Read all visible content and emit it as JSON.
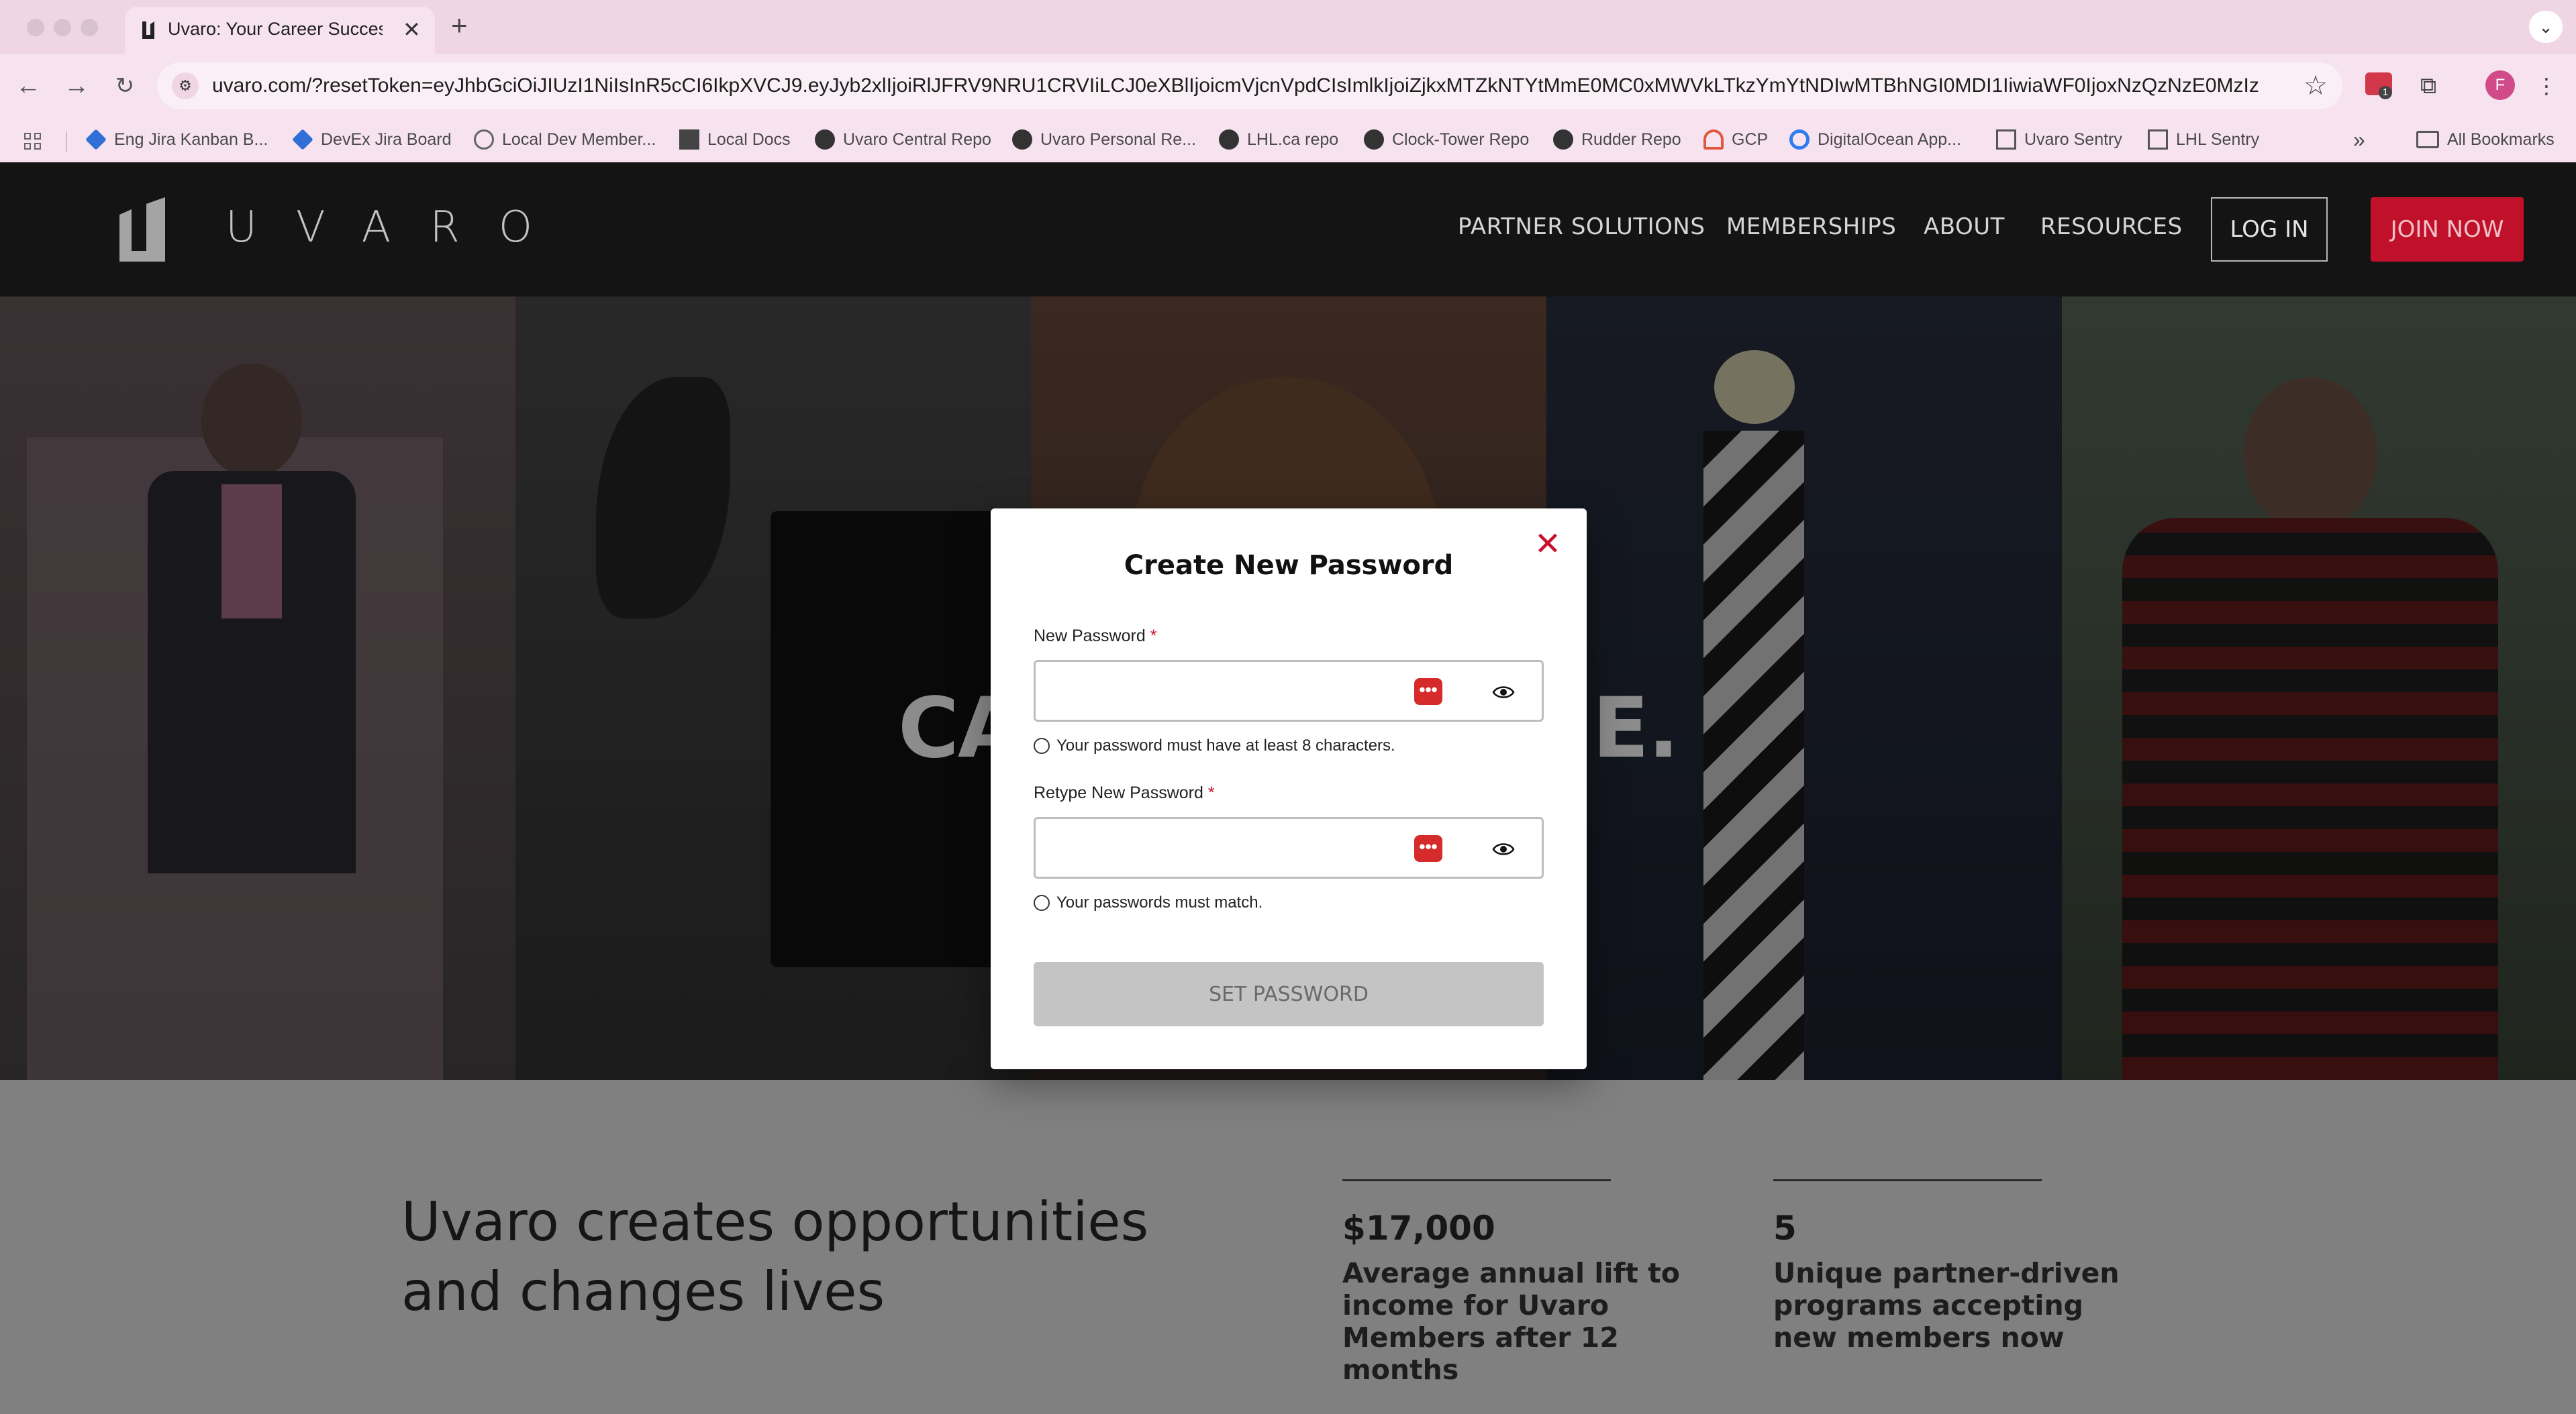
{
  "browser": {
    "tab_title": "Uvaro: Your Career Success C",
    "tab_close": "✕",
    "new_tab": "+",
    "tab_menu": "⌄",
    "url": "uvaro.com/?resetToken=eyJhbGciOiJIUzI1NiIsInR5cCI6IkpXVCJ9.eyJyb2xlIjoiRlJFRV9NRU1CRVIiLCJ0eXBlIjoicmVjcnVpdCIsImlkIjoiZjkxMTZkNTYtMmE0MC0xMWVkLTkzYmYtNDIwMTBhNGI0MDI1IiwiaWF0IjoxNzQzNzE0MzIzLCJleHAi...",
    "avatar_initial": "F",
    "ext_badge_count": "1",
    "bookmarks": [
      {
        "label": "Eng Jira Kanban B...",
        "icon": "jira-icon"
      },
      {
        "label": "DevEx Jira Board",
        "icon": "jira-icon"
      },
      {
        "label": "Local Dev Member...",
        "icon": "globe-icon"
      },
      {
        "label": "Local Docs",
        "icon": "doc-icon"
      },
      {
        "label": "Uvaro Central Repo",
        "icon": "github-icon"
      },
      {
        "label": "Uvaro Personal Re...",
        "icon": "github-icon"
      },
      {
        "label": "LHL.ca repo",
        "icon": "github-icon"
      },
      {
        "label": "Clock-Tower Repo",
        "icon": "github-icon"
      },
      {
        "label": "Rudder Repo",
        "icon": "github-icon"
      },
      {
        "label": "GCP",
        "icon": "gcp-icon"
      },
      {
        "label": "DigitalOcean App...",
        "icon": "digitalocean-icon"
      },
      {
        "label": "Uvaro Sentry",
        "icon": "sentry-icon"
      },
      {
        "label": "LHL Sentry",
        "icon": "sentry-icon"
      }
    ],
    "bookmarks_overflow": "»",
    "all_bookmarks": "All Bookmarks"
  },
  "site": {
    "logo_text": "UVARO",
    "nav": [
      "PARTNER SOLUTIONS",
      "MEMBERSHIPS",
      "ABOUT",
      "RESOURCES"
    ],
    "login_label": "LOG IN",
    "join_label": "JOIN NOW",
    "hero_line1": "CARE                      YOU.",
    "hero_line2": "CAREER                       ERYONE.",
    "stats_headline": "Uvaro creates opportunities and changes lives",
    "stats": [
      {
        "value": "$17,000",
        "label": "Average annual lift to income for Uvaro Members after 12 months"
      },
      {
        "value": "5",
        "label": "Unique partner-driven programs accepting new members now"
      }
    ]
  },
  "modal": {
    "close_label": "✕",
    "title": "Create New Password",
    "new_password_label": "New Password",
    "retype_password_label": "Retype New Password",
    "required_marker": "*",
    "new_password_value": "",
    "retype_password_value": "",
    "password_manager_glyph": "•••",
    "hint_length": "Your password must have at least 8 characters.",
    "hint_match": "Your passwords must match.",
    "submit_label": "SET PASSWORD"
  },
  "colors": {
    "brand_red": "#c0102a",
    "close_red": "#c8102e",
    "chrome_pink": "#f6e3ef"
  }
}
